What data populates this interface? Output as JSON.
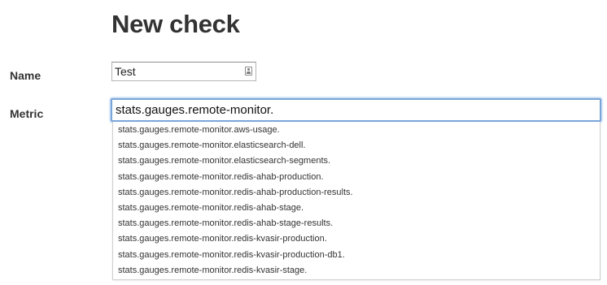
{
  "page": {
    "title": "New check"
  },
  "form": {
    "name": {
      "label": "Name",
      "value": "Test",
      "icon": "contact-card-icon"
    },
    "metric": {
      "label": "Metric",
      "value": "stats.gauges.remote-monitor.",
      "suggestions": [
        "stats.gauges.remote-monitor.aws-usage.",
        "stats.gauges.remote-monitor.elasticsearch-dell.",
        "stats.gauges.remote-monitor.elasticsearch-segments.",
        "stats.gauges.remote-monitor.redis-ahab-production.",
        "stats.gauges.remote-monitor.redis-ahab-production-results.",
        "stats.gauges.remote-monitor.redis-ahab-stage.",
        "stats.gauges.remote-monitor.redis-ahab-stage-results.",
        "stats.gauges.remote-monitor.redis-kvasir-production.",
        "stats.gauges.remote-monitor.redis-kvasir-production-db1.",
        "stats.gauges.remote-monitor.redis-kvasir-stage."
      ]
    }
  },
  "colors": {
    "focus_border": "#7aa7d8",
    "text": "#333333"
  }
}
